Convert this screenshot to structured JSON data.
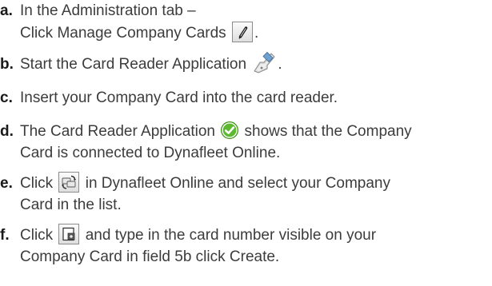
{
  "steps": [
    {
      "letter": "a.",
      "line1": "In the Administration tab –",
      "line2_pre": "Click Manage Company Cards ",
      "line2_post": "."
    },
    {
      "letter": "b.",
      "pre": "Start the Card Reader Application ",
      "post": "."
    },
    {
      "letter": "c.",
      "text": "Insert your Company Card into the card reader."
    },
    {
      "letter": "d.",
      "pre": "The Card Reader Application ",
      "post": " shows that the Company",
      "line2": "Card is connected to Dynafleet Online."
    },
    {
      "letter": "e.",
      "pre": "Click ",
      "post": " in Dynafleet Online and select your Company",
      "line2": "Card in the list."
    },
    {
      "letter": "f.",
      "pre": "Click ",
      "post": " and type in the card number visible on your",
      "line2": "Company Card in field 5b click Create."
    }
  ],
  "icons": {
    "manage_cards": "pencil-icon",
    "card_reader_app": "card-reader-icon",
    "connected": "checkmark-icon",
    "sync": "refresh-icon",
    "new": "new-card-icon"
  },
  "colors": {
    "text": "#3c3c3c",
    "letter": "#1a1a1a",
    "check_green": "#5cb82f"
  }
}
